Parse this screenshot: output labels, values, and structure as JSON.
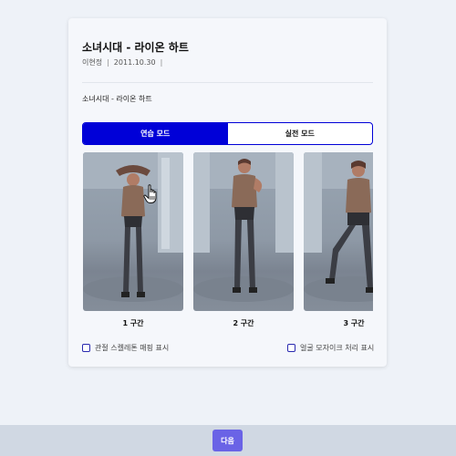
{
  "card": {
    "title": "소녀시대 - 라이온 하트",
    "meta": {
      "author": "이현정",
      "date": "2011.10.30"
    },
    "subtitle": "소녀시대 - 라이온 하트"
  },
  "mode_toggle": {
    "practice_label": "연습 모드",
    "live_label": "실전 모드",
    "selected": "연습 모드"
  },
  "segments": [
    {
      "label": "1 구간"
    },
    {
      "label": "2 구간"
    },
    {
      "label": "3 구간"
    }
  ],
  "options": {
    "skeleton_label": "관절 스켈레톤 매핑 표시",
    "mosaic_label": "얼굴 모자이크 처리 표시"
  },
  "footer": {
    "next_label": "다음"
  },
  "colors": {
    "accent": "#0000d8",
    "next_button": "#6a63e6",
    "footer_bg": "#d0d8e3",
    "page_bg": "#eef2f8"
  }
}
